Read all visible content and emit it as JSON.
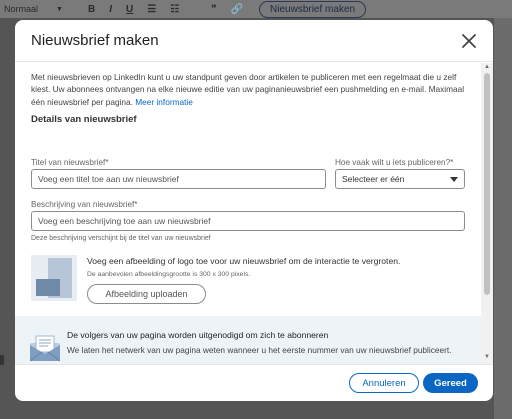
{
  "background": {
    "format_select": "Normaal",
    "create_newsletter_button": "Nieuwsbrief maken"
  },
  "modal": {
    "title": "Nieuwsbrief maken",
    "intro_text": "Met nieuwsbrieven op LinkedIn kunt u uw standpunt geven door artikelen te publiceren met een regelmaat die u zelf kiest. Uw abonnees ontvangen na elke nieuwe editie van uw paginanieuwsbrief een pushmelding en e-mail. Maximaal één nieuwsbrief per pagina.",
    "intro_link": "Meer informatie",
    "section_title": "Details van nieuwsbrief",
    "title_field": {
      "label": "Titel van nieuwsbrief*",
      "placeholder": "Voeg een titel toe aan uw nieuwsbrief"
    },
    "frequency_field": {
      "label": "Hoe vaak wilt u iets publiceren?*",
      "selected": "Selecteer er één"
    },
    "description_field": {
      "label": "Beschrijving van nieuwsbrief*",
      "placeholder": "Voeg een beschrijving toe aan uw nieuwsbrief",
      "helper": "Deze beschrijving verschijnt bij de titel van uw nieuwsbrief"
    },
    "image": {
      "title": "Voeg een afbeelding of logo toe voor uw nieuwsbrief om de interactie te vergroten.",
      "hint": "De aanbevolen afbeeldingsgrootte is 300 x 300 pixels.",
      "upload_button": "Afbeelding uploaden"
    },
    "notice": {
      "title": "De volgers van uw pagina worden uitgenodigd om zich te abonneren",
      "text": "We laten het netwerk van uw pagina weten wanneer u het eerste nummer van uw nieuwsbrief publiceert."
    },
    "footer": {
      "cancel_button": "Annuleren",
      "done_button": "Gereed"
    }
  },
  "colors": {
    "accent": "#0a66c2",
    "notice_bg": "#eef3f8",
    "overlay": "#555555"
  }
}
